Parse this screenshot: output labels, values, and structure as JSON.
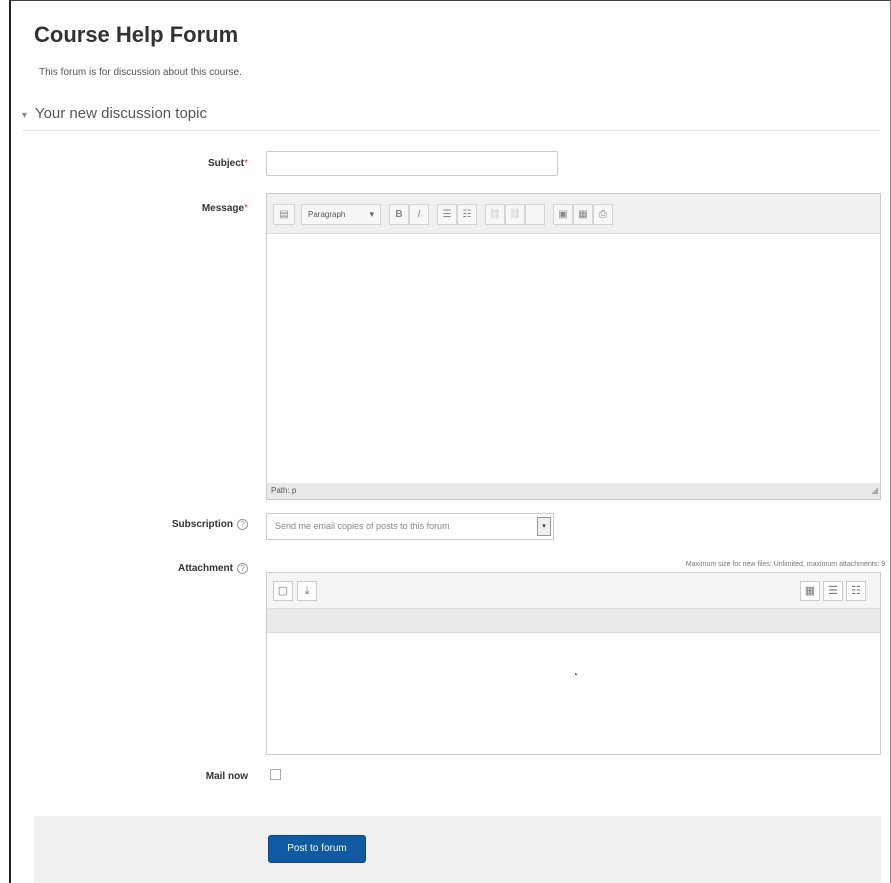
{
  "forum": {
    "title": "Course Help Forum",
    "description": "This forum is for discussion about this course."
  },
  "form": {
    "section_toggle": "▾",
    "section_title": "Your new discussion topic",
    "subject": {
      "label": "Subject",
      "required_mark": "*",
      "value": ""
    },
    "message": {
      "label": "Message",
      "required_mark": "*",
      "toolbar": {
        "toggle_icon": "▤",
        "paragraph_label": "Paragraph",
        "dropdown_arrow": "▾",
        "bold": "B",
        "italic": "I",
        "bullet_list_icon": "☰",
        "numbered_list_icon": "☷",
        "link_icon": "⛓",
        "unlink_icon": "⛓",
        "blank_icon": " ",
        "image_icon": "▣",
        "media_icon": "▦",
        "file_icon": "⎙"
      },
      "status_path": "Path: p",
      "resize_grip": "◢"
    },
    "subscription": {
      "label": "Subscription",
      "help_icon": "?",
      "selected": "Send me email copies of posts to this forum",
      "arrow": "▾"
    },
    "attachment": {
      "label": "Attachment",
      "help_icon": "?",
      "max_note": "Maximum size for new files: Unlimited, maximum attachments: 9",
      "toolbar": {
        "add_file_icon": "▢",
        "download_icon": "⤓",
        "view_icons": "▦",
        "view_list": "☰",
        "view_tree": "☷"
      },
      "spinner": "◔"
    },
    "mail_now": {
      "label": "Mail now",
      "checked": false
    },
    "submit_label": "Post to forum"
  },
  "colors": {
    "button_primary": "#0f5aa0",
    "required": "#b94a48",
    "footer_band": "#f0f0f0"
  }
}
